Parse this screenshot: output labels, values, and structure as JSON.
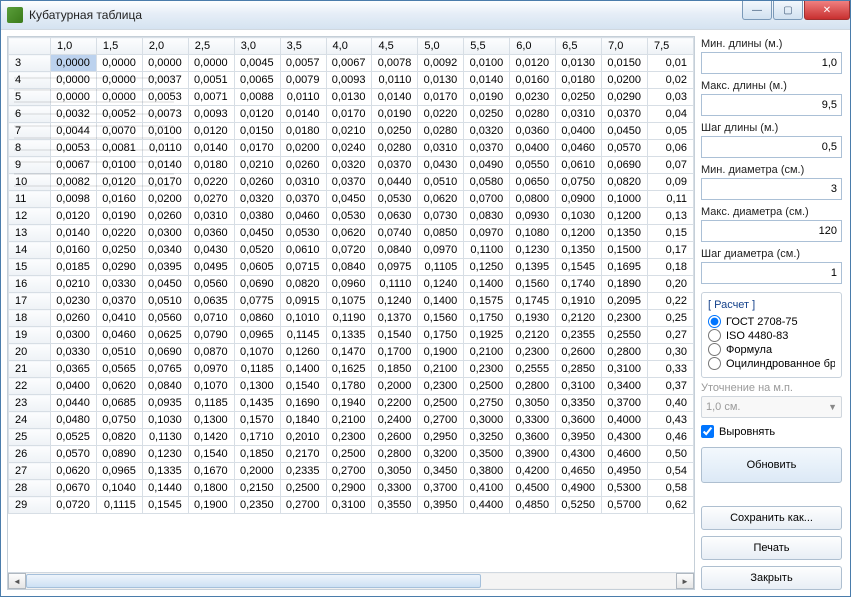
{
  "window": {
    "title": "Кубатурная таблица"
  },
  "table": {
    "columns": [
      "1,0",
      "1,5",
      "2,0",
      "2,5",
      "3,0",
      "3,5",
      "4,0",
      "4,5",
      "5,0",
      "5,5",
      "6,0",
      "6,5",
      "7,0",
      "7,5"
    ],
    "last_col_clip": "0,01",
    "rows": [
      {
        "h": "3",
        "c": [
          "0,0000",
          "0,0000",
          "0,0000",
          "0,0000",
          "0,0045",
          "0,0057",
          "0,0067",
          "0,0078",
          "0,0092",
          "0,0100",
          "0,0120",
          "0,0130",
          "0,0150",
          "0,01"
        ]
      },
      {
        "h": "4",
        "c": [
          "0,0000",
          "0,0000",
          "0,0037",
          "0,0051",
          "0,0065",
          "0,0079",
          "0,0093",
          "0,0110",
          "0,0130",
          "0,0140",
          "0,0160",
          "0,0180",
          "0,0200",
          "0,02"
        ]
      },
      {
        "h": "5",
        "c": [
          "0,0000",
          "0,0000",
          "0,0053",
          "0,0071",
          "0,0088",
          "0,0110",
          "0,0130",
          "0,0140",
          "0,0170",
          "0,0190",
          "0,0230",
          "0,0250",
          "0,0290",
          "0,03"
        ]
      },
      {
        "h": "6",
        "c": [
          "0,0032",
          "0,0052",
          "0,0073",
          "0,0093",
          "0,0120",
          "0,0140",
          "0,0170",
          "0,0190",
          "0,0220",
          "0,0250",
          "0,0280",
          "0,0310",
          "0,0370",
          "0,04"
        ]
      },
      {
        "h": "7",
        "c": [
          "0,0044",
          "0,0070",
          "0,0100",
          "0,0120",
          "0,0150",
          "0,0180",
          "0,0210",
          "0,0250",
          "0,0280",
          "0,0320",
          "0,0360",
          "0,0400",
          "0,0450",
          "0,05"
        ]
      },
      {
        "h": "8",
        "c": [
          "0,0053",
          "0,0081",
          "0,0110",
          "0,0140",
          "0,0170",
          "0,0200",
          "0,0240",
          "0,0280",
          "0,0310",
          "0,0370",
          "0,0400",
          "0,0460",
          "0,0570",
          "0,06"
        ]
      },
      {
        "h": "9",
        "c": [
          "0,0067",
          "0,0100",
          "0,0140",
          "0,0180",
          "0,0210",
          "0,0260",
          "0,0320",
          "0,0370",
          "0,0430",
          "0,0490",
          "0,0550",
          "0,0610",
          "0,0690",
          "0,07"
        ]
      },
      {
        "h": "10",
        "c": [
          "0,0082",
          "0,0120",
          "0,0170",
          "0,0220",
          "0,0260",
          "0,0310",
          "0,0370",
          "0,0440",
          "0,0510",
          "0,0580",
          "0,0650",
          "0,0750",
          "0,0820",
          "0,09"
        ]
      },
      {
        "h": "11",
        "c": [
          "0,0098",
          "0,0160",
          "0,0200",
          "0,0270",
          "0,0320",
          "0,0370",
          "0,0450",
          "0,0530",
          "0,0620",
          "0,0700",
          "0,0800",
          "0,0900",
          "0,1000",
          "0,11"
        ]
      },
      {
        "h": "12",
        "c": [
          "0,0120",
          "0,0190",
          "0,0260",
          "0,0310",
          "0,0380",
          "0,0460",
          "0,0530",
          "0,0630",
          "0,0730",
          "0,0830",
          "0,0930",
          "0,1030",
          "0,1200",
          "0,13"
        ]
      },
      {
        "h": "13",
        "c": [
          "0,0140",
          "0,0220",
          "0,0300",
          "0,0360",
          "0,0450",
          "0,0530",
          "0,0620",
          "0,0740",
          "0,0850",
          "0,0970",
          "0,1080",
          "0,1200",
          "0,1350",
          "0,15"
        ]
      },
      {
        "h": "14",
        "c": [
          "0,0160",
          "0,0250",
          "0,0340",
          "0,0430",
          "0,0520",
          "0,0610",
          "0,0720",
          "0,0840",
          "0,0970",
          "0,1100",
          "0,1230",
          "0,1350",
          "0,1500",
          "0,17"
        ]
      },
      {
        "h": "15",
        "c": [
          "0,0185",
          "0,0290",
          "0,0395",
          "0,0495",
          "0,0605",
          "0,0715",
          "0,0840",
          "0,0975",
          "0,1105",
          "0,1250",
          "0,1395",
          "0,1545",
          "0,1695",
          "0,18"
        ]
      },
      {
        "h": "16",
        "c": [
          "0,0210",
          "0,0330",
          "0,0450",
          "0,0560",
          "0,0690",
          "0,0820",
          "0,0960",
          "0,1110",
          "0,1240",
          "0,1400",
          "0,1560",
          "0,1740",
          "0,1890",
          "0,20"
        ]
      },
      {
        "h": "17",
        "c": [
          "0,0230",
          "0,0370",
          "0,0510",
          "0,0635",
          "0,0775",
          "0,0915",
          "0,1075",
          "0,1240",
          "0,1400",
          "0,1575",
          "0,1745",
          "0,1910",
          "0,2095",
          "0,22"
        ]
      },
      {
        "h": "18",
        "c": [
          "0,0260",
          "0,0410",
          "0,0560",
          "0,0710",
          "0,0860",
          "0,1010",
          "0,1190",
          "0,1370",
          "0,1560",
          "0,1750",
          "0,1930",
          "0,2120",
          "0,2300",
          "0,25"
        ]
      },
      {
        "h": "19",
        "c": [
          "0,0300",
          "0,0460",
          "0,0625",
          "0,0790",
          "0,0965",
          "0,1145",
          "0,1335",
          "0,1540",
          "0,1750",
          "0,1925",
          "0,2120",
          "0,2355",
          "0,2550",
          "0,27"
        ]
      },
      {
        "h": "20",
        "c": [
          "0,0330",
          "0,0510",
          "0,0690",
          "0,0870",
          "0,1070",
          "0,1260",
          "0,1470",
          "0,1700",
          "0,1900",
          "0,2100",
          "0,2300",
          "0,2600",
          "0,2800",
          "0,30"
        ]
      },
      {
        "h": "21",
        "c": [
          "0,0365",
          "0,0565",
          "0,0765",
          "0,0970",
          "0,1185",
          "0,1400",
          "0,1625",
          "0,1850",
          "0,2100",
          "0,2300",
          "0,2555",
          "0,2850",
          "0,3100",
          "0,33"
        ]
      },
      {
        "h": "22",
        "c": [
          "0,0400",
          "0,0620",
          "0,0840",
          "0,1070",
          "0,1300",
          "0,1540",
          "0,1780",
          "0,2000",
          "0,2300",
          "0,2500",
          "0,2800",
          "0,3100",
          "0,3400",
          "0,37"
        ]
      },
      {
        "h": "23",
        "c": [
          "0,0440",
          "0,0685",
          "0,0935",
          "0,1185",
          "0,1435",
          "0,1690",
          "0,1940",
          "0,2200",
          "0,2500",
          "0,2750",
          "0,3050",
          "0,3350",
          "0,3700",
          "0,40"
        ]
      },
      {
        "h": "24",
        "c": [
          "0,0480",
          "0,0750",
          "0,1030",
          "0,1300",
          "0,1570",
          "0,1840",
          "0,2100",
          "0,2400",
          "0,2700",
          "0,3000",
          "0,3300",
          "0,3600",
          "0,4000",
          "0,43"
        ]
      },
      {
        "h": "25",
        "c": [
          "0,0525",
          "0,0820",
          "0,1130",
          "0,1420",
          "0,1710",
          "0,2010",
          "0,2300",
          "0,2600",
          "0,2950",
          "0,3250",
          "0,3600",
          "0,3950",
          "0,4300",
          "0,46"
        ]
      },
      {
        "h": "26",
        "c": [
          "0,0570",
          "0,0890",
          "0,1230",
          "0,1540",
          "0,1850",
          "0,2170",
          "0,2500",
          "0,2800",
          "0,3200",
          "0,3500",
          "0,3900",
          "0,4300",
          "0,4600",
          "0,50"
        ]
      },
      {
        "h": "27",
        "c": [
          "0,0620",
          "0,0965",
          "0,1335",
          "0,1670",
          "0,2000",
          "0,2335",
          "0,2700",
          "0,3050",
          "0,3450",
          "0,3800",
          "0,4200",
          "0,4650",
          "0,4950",
          "0,54"
        ]
      },
      {
        "h": "28",
        "c": [
          "0,0670",
          "0,1040",
          "0,1440",
          "0,1800",
          "0,2150",
          "0,2500",
          "0,2900",
          "0,3300",
          "0,3700",
          "0,4100",
          "0,4500",
          "0,4900",
          "0,5300",
          "0,58"
        ]
      },
      {
        "h": "29",
        "c": [
          "0,0720",
          "0,1115",
          "0,1545",
          "0,1900",
          "0,2350",
          "0,2700",
          "0,3100",
          "0,3550",
          "0,3950",
          "0,4400",
          "0,4850",
          "0,5250",
          "0,5700",
          "0,62"
        ]
      }
    ]
  },
  "side": {
    "min_len_label": "Мин. длины (м.)",
    "min_len": "1,0",
    "max_len_label": "Макс. длины (м.)",
    "max_len": "9,5",
    "step_len_label": "Шаг длины (м.)",
    "step_len": "0,5",
    "min_dia_label": "Мин. диаметра (см.)",
    "min_dia": "3",
    "max_dia_label": "Макс. диаметра (см.)",
    "max_dia": "120",
    "step_dia_label": "Шаг диаметра (см.)",
    "step_dia": "1",
    "calc_legend": "[ Расчет ]",
    "calc_gost": "ГОСТ 2708-75",
    "calc_iso": "ISO 4480-83",
    "calc_formula": "Формула",
    "calc_round": "Оцилиндрованное бр",
    "refine_label": "Уточнение на м.п.",
    "refine_value": "1,0 см.",
    "align_label": "Выровнять",
    "btn_update": "Обновить",
    "btn_save": "Сохранить как...",
    "btn_print": "Печать",
    "btn_close": "Закрыть"
  }
}
